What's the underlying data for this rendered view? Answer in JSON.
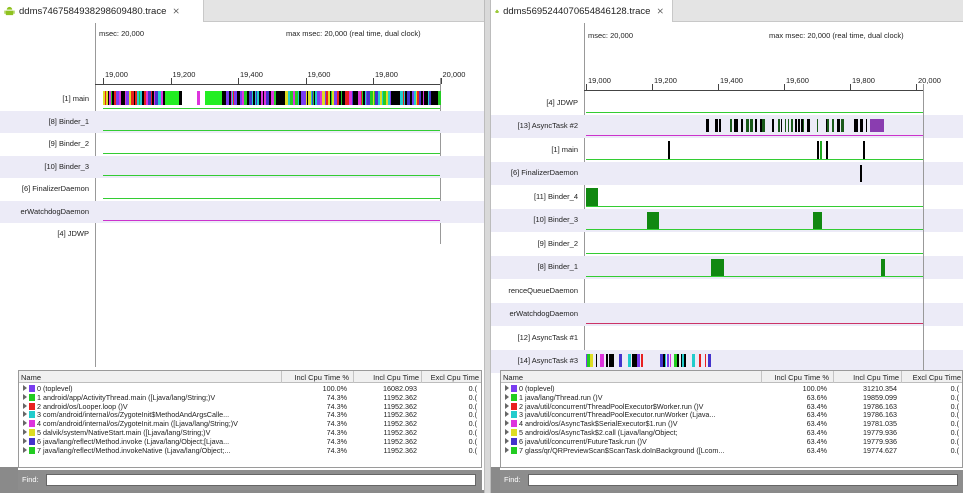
{
  "left": {
    "tab_title": "ddms7467584938298609480.trace",
    "msec": "msec: 20,000",
    "max_msec": "max msec: 20,000 (real time, dual clock)",
    "ticks": [
      "19,000",
      "19,200",
      "19,400",
      "19,600",
      "19,800",
      "20,000"
    ],
    "threads": [
      {
        "label": "[1] main",
        "color": "#33cc33"
      },
      {
        "label": "[8] Binder_1",
        "color": "#33cc33"
      },
      {
        "label": "[9] Binder_2",
        "color": "#33cc33"
      },
      {
        "label": "[10] Binder_3",
        "color": "#33cc33"
      },
      {
        "label": "[6] FinalizerDaemon",
        "color": "#33cc33"
      },
      {
        "label": "erWatchdogDaemon",
        "color": "#cc33cc"
      },
      {
        "label": "[4] JDWP",
        "color": ""
      }
    ],
    "columns": [
      "Name",
      "Incl Cpu Time %",
      "Incl Cpu Time",
      "Excl Cpu Time"
    ],
    "rows": [
      {
        "name": "0 (toplevel)",
        "color": "#7a3df0",
        "pct": "100.0%",
        "time": "16082.093",
        "excl": "0.("
      },
      {
        "name": "1 android/app/ActivityThread.main ([Ljava/lang/String;)V",
        "color": "#22cc22",
        "pct": "74.3%",
        "time": "11952.362",
        "excl": "0.("
      },
      {
        "name": "2 android/os/Looper.loop ()V",
        "color": "#e82020",
        "pct": "74.3%",
        "time": "11952.362",
        "excl": "0.("
      },
      {
        "name": "3 com/android/internal/os/ZygoteInit$MethodAndArgsCalle...",
        "color": "#22cccc",
        "pct": "74.3%",
        "time": "11952.362",
        "excl": "0.("
      },
      {
        "name": "4 com/android/internal/os/ZygoteInit.main ([Ljava/lang/String;)V",
        "color": "#dd33dd",
        "pct": "74.3%",
        "time": "11952.362",
        "excl": "0.("
      },
      {
        "name": "5 dalvik/system/NativeStart.main ([Ljava/lang/String;)V",
        "color": "#dddd22",
        "pct": "74.3%",
        "time": "11952.362",
        "excl": "0.("
      },
      {
        "name": "6 java/lang/reflect/Method.invoke (Ljava/lang/Object;[Ljava...",
        "color": "#4433cc",
        "pct": "74.3%",
        "time": "11952.362",
        "excl": "0.("
      },
      {
        "name": "7 java/lang/reflect/Method.invokeNative (Ljava/lang/Object;...",
        "color": "#22cc22",
        "pct": "74.3%",
        "time": "11952.362",
        "excl": "0.("
      }
    ],
    "find_label": "Find:"
  },
  "right": {
    "tab_title": "ddms5695244070654846128.trace",
    "msec": "msec: 20,000",
    "max_msec": "max msec: 20,000 (real time, dual clock)",
    "ticks": [
      "19,000",
      "19,200",
      "19,400",
      "19,600",
      "19,800",
      "20,000"
    ],
    "threads": [
      {
        "label": "[4] JDWP",
        "color": "#33cc33"
      },
      {
        "label": "[13] AsyncTask #2",
        "color": "#cc33cc"
      },
      {
        "label": "[1] main",
        "color": "#33cc33"
      },
      {
        "label": "[6] FinalizerDaemon",
        "color": ""
      },
      {
        "label": "[11] Binder_4",
        "color": "#33cc33"
      },
      {
        "label": "[10] Binder_3",
        "color": "#33cc33"
      },
      {
        "label": "[9] Binder_2",
        "color": "#33cc33"
      },
      {
        "label": "[8] Binder_1",
        "color": "#33cc33"
      },
      {
        "label": "renceQueueDaemon",
        "color": ""
      },
      {
        "label": "erWatchdogDaemon",
        "color": "#cc3366"
      },
      {
        "label": "[12] AsyncTask #1",
        "color": ""
      },
      {
        "label": "[14] AsyncTask #3",
        "color": ""
      }
    ],
    "columns": [
      "Name",
      "Incl Cpu Time %",
      "Incl Cpu Time",
      "Excl Cpu Time"
    ],
    "rows": [
      {
        "name": "0 (toplevel)",
        "color": "#7a3df0",
        "pct": "100.0%",
        "time": "31210.354",
        "excl": "0.("
      },
      {
        "name": "1 java/lang/Thread.run ()V",
        "color": "#22cc22",
        "pct": "63.6%",
        "time": "19859.099",
        "excl": "0.("
      },
      {
        "name": "2 java/util/concurrent/ThreadPoolExecutor$Worker.run ()V",
        "color": "#e82020",
        "pct": "63.4%",
        "time": "19786.163",
        "excl": "0.("
      },
      {
        "name": "3 java/util/concurrent/ThreadPoolExecutor.runWorker (Ljava...",
        "color": "#22cccc",
        "pct": "63.4%",
        "time": "19786.163",
        "excl": "0.("
      },
      {
        "name": "4 android/os/AsyncTask$SerialExecutor$1.run ()V",
        "color": "#dd33dd",
        "pct": "63.4%",
        "time": "19781.035",
        "excl": "0.("
      },
      {
        "name": "5 android/os/AsyncTask$2.call (Ljava/lang/Object;",
        "color": "#dddd22",
        "pct": "63.4%",
        "time": "19779.936",
        "excl": "0.("
      },
      {
        "name": "6 java/util/concurrent/FutureTask.run ()V",
        "color": "#4433cc",
        "pct": "63.4%",
        "time": "19779.936",
        "excl": "0.("
      },
      {
        "name": "7 glass/qr/QRPreviewScan$ScanTask.doInBackground ([Lcom...",
        "color": "#22cc22",
        "pct": "63.4%",
        "time": "19774.627",
        "excl": "0.("
      }
    ],
    "find_label": "Find:"
  }
}
